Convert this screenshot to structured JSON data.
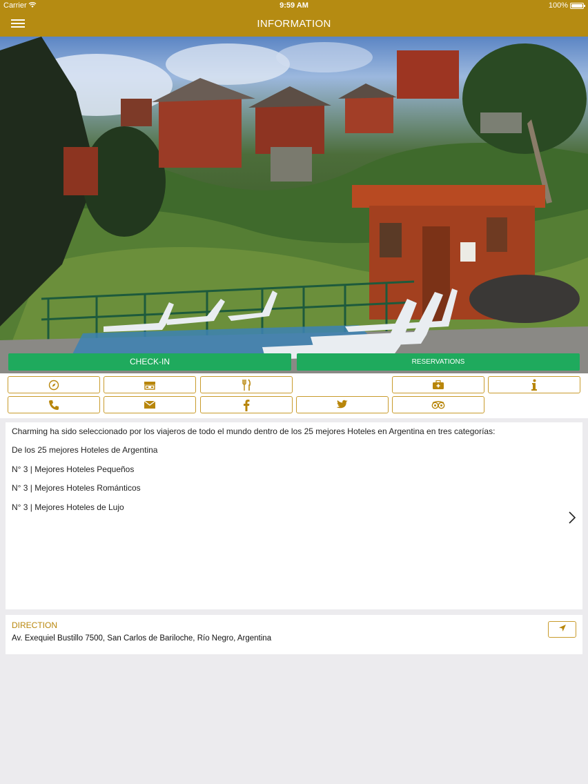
{
  "status_bar": {
    "carrier": "Carrier",
    "time": "9:59 AM",
    "battery": "100%"
  },
  "nav": {
    "title": "INFORMATION"
  },
  "actions": {
    "checkin_label": "CHECK-IN",
    "reservations_label": "RESERVATIONS"
  },
  "icon_grid": [
    {
      "icon": "compass-icon"
    },
    {
      "icon": "concierge-desk-icon"
    },
    {
      "icon": "restaurant-icon"
    },
    {
      "icon": "first-aid-kit-icon"
    },
    {
      "icon": "info-icon"
    },
    {
      "icon": "phone-icon"
    },
    {
      "icon": "envelope-icon"
    },
    {
      "icon": "facebook-icon"
    },
    {
      "icon": "twitter-icon"
    },
    {
      "icon": "tripadvisor-icon"
    }
  ],
  "description": {
    "lines": [
      "Charming ha sido seleccionado por los viajeros de todo el mundo dentro de los 25 mejores Hoteles en Argentina en tres categorías:",
      "De los 25 mejores Hoteles de Argentina",
      "N° 3 | Mejores Hoteles Pequeños",
      "N° 3 | Mejores Hoteles Románticos",
      "N° 3 | Mejores Hoteles de Lujo"
    ]
  },
  "direction": {
    "label": "DIRECTION",
    "address": "Av. Exequiel Bustillo 7500, San Carlos de Bariloche, Río Negro, Argentina"
  },
  "colors": {
    "brand_gold": "#b58b12",
    "accent_green": "#1faa5d",
    "outline_gold": "#c89a2a"
  }
}
